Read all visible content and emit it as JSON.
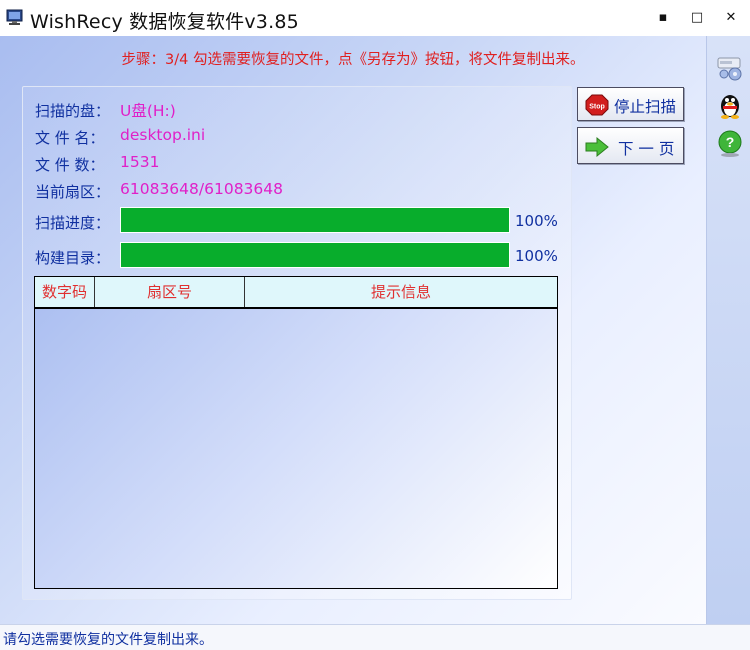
{
  "window": {
    "title": "WishRecy 数据恢复软件v3.85",
    "min": "▪",
    "max": "□",
    "close": "✕"
  },
  "step": "步骤：3/4 勾选需要恢复的文件，点《另存为》按钮，将文件复制出来。",
  "info": {
    "disk_label": "扫描的盘：",
    "disk_value": "U盘(H:)",
    "file_label": "文 件 名：",
    "file_value": "desktop.ini",
    "count_label": "文 件 数：",
    "count_value": "1531",
    "sector_label": "当前扇区：",
    "sector_value": "61083648/61083648"
  },
  "progress": {
    "scan_label": "扫描进度：",
    "scan_pct_text": "100%",
    "scan_fraction": 1.0,
    "build_label": "构建目录：",
    "build_pct_text": "100%",
    "build_fraction": 1.0
  },
  "table": {
    "columns": [
      "数字码",
      "扇区号",
      "提示信息"
    ],
    "rows": []
  },
  "buttons": {
    "stop": "停止扫描",
    "stop_icon_text": "Stop",
    "next": "下 一 页"
  },
  "side_tools": [
    "settings-disk-icon",
    "qq-penguin-icon",
    "help-icon"
  ],
  "colors": {
    "label_blue": "#1030a0",
    "value_magenta": "#e020c8",
    "progress_green": "#08ad2c",
    "step_red": "#e02020"
  },
  "status": "请勾选需要恢复的文件复制出来。"
}
